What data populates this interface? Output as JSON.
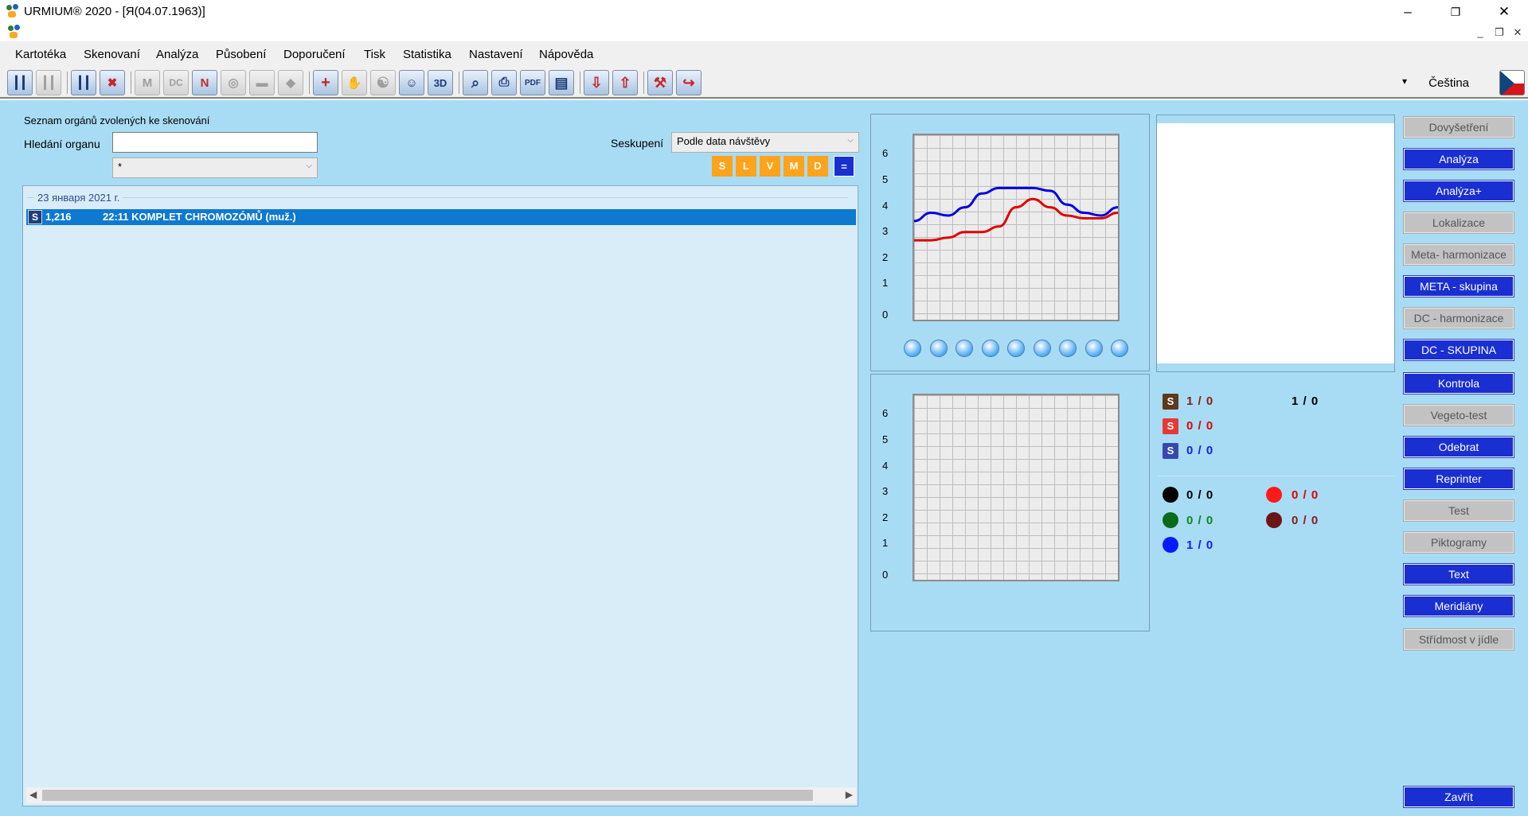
{
  "window": {
    "title": "URMIUM® 2020 - [Я(04.07.1963)]",
    "controls": {
      "minimize": "–",
      "maximize": "❐",
      "close": "✕"
    },
    "mdi_controls": {
      "minimize": "_",
      "restore": "❒",
      "close": "✕"
    }
  },
  "menu": [
    "Kartotéka",
    "Skenovaní",
    "Analýza",
    "Působení",
    "Doporučení",
    "Tisk",
    "Statistika",
    "Nastavení",
    "Nápověda"
  ],
  "toolbar": {
    "icons": [
      {
        "name": "scan-group-icon",
        "glyph": "┃┃"
      },
      {
        "name": "scan-compare-icon",
        "glyph": "┃┃"
      },
      {
        "name": "body-scan-icon",
        "glyph": "┃┃"
      },
      {
        "name": "organ-cancel-icon",
        "glyph": "✖"
      },
      {
        "name": "meta-icon",
        "glyph": "M"
      },
      {
        "name": "dc-icon",
        "glyph": "DC"
      },
      {
        "name": "neo-chart-icon",
        "glyph": "N"
      },
      {
        "name": "food-icon",
        "glyph": "◎"
      },
      {
        "name": "folder-icon",
        "glyph": "▬"
      },
      {
        "name": "drop-icon",
        "glyph": "◆"
      },
      {
        "name": "add-medical-icon",
        "glyph": "+"
      },
      {
        "name": "hand-icon",
        "glyph": "✋"
      },
      {
        "name": "yin-yang-icon",
        "glyph": "☯"
      },
      {
        "name": "body-view-icon",
        "glyph": "☺"
      },
      {
        "name": "3d-icon",
        "glyph": "3D"
      },
      {
        "name": "magnifier-icon",
        "glyph": "⌕"
      },
      {
        "name": "printer-icon",
        "glyph": "⎙"
      },
      {
        "name": "pdf-mail-icon",
        "glyph": "PDF"
      },
      {
        "name": "book-icon",
        "glyph": "▤"
      },
      {
        "name": "import-icon",
        "glyph": "⇩"
      },
      {
        "name": "export-icon",
        "glyph": "⇧"
      },
      {
        "name": "tools-icon",
        "glyph": "⚒"
      },
      {
        "name": "exit-icon",
        "glyph": "↪"
      }
    ],
    "language": "Čeština",
    "language_arrow": "▾"
  },
  "left": {
    "list_title": "Seznam orgánů zvolených ke skenování",
    "search_label": "Hledání organu",
    "search_value": "",
    "filter_value": "*",
    "group_label": "Seskupení",
    "group_value": "Podle data návštěvy",
    "filter_buttons": [
      "S",
      "L",
      "V",
      "M",
      "D",
      "="
    ],
    "group_header": "23 января 2021 г.",
    "rows": [
      {
        "icon": "S",
        "value": "1,216",
        "time_name": "22:11 KOMPLET CHROMOZÓMŮ (muž.)"
      }
    ]
  },
  "chart_data": [
    {
      "type": "line",
      "ylim": [
        0,
        7
      ],
      "yticks": [
        "0",
        "1",
        "2",
        "3",
        "4",
        "5",
        "6"
      ],
      "x": [
        0,
        1,
        2,
        3,
        4,
        5,
        6,
        7,
        8,
        9,
        10,
        11,
        12
      ],
      "series": [
        {
          "color": "#0000e0",
          "values": [
            3.3,
            3.6,
            3.5,
            3.8,
            4.3,
            4.5,
            4.5,
            4.5,
            4.4,
            3.9,
            3.6,
            3.5,
            3.8
          ]
        },
        {
          "color": "#e00000",
          "values": [
            2.6,
            2.6,
            2.7,
            2.9,
            2.9,
            3.1,
            3.8,
            4.1,
            3.8,
            3.5,
            3.4,
            3.4,
            3.6
          ]
        }
      ]
    },
    {
      "type": "line",
      "ylim": [
        0,
        7
      ],
      "yticks": [
        "0",
        "1",
        "2",
        "3",
        "4",
        "5",
        "6"
      ],
      "x": [],
      "series": []
    }
  ],
  "organ_icons": [
    "lung-icon",
    "nerve-icon",
    "sweat-icon",
    "joint-icon",
    "virus-icon",
    "stomach-icon",
    "bug-icon",
    "drop-icon",
    "brain-icon"
  ],
  "stats": {
    "s_black": {
      "value": "1 / 0",
      "extra": "1 / 0"
    },
    "s_red": {
      "value": "0 / 0"
    },
    "s_blue": {
      "value": "0 / 0"
    },
    "dots": [
      {
        "color": "#000000",
        "value": "0 / 0"
      },
      {
        "color": "#ff1a1a",
        "value": "0 / 0"
      },
      {
        "color": "#0a6b1a",
        "value": "0 / 0"
      },
      {
        "color": "#6b1515",
        "value": "0 / 0"
      },
      {
        "color": "#0a1aff",
        "value": "1 / 0"
      }
    ]
  },
  "side_buttons": [
    {
      "label": "Dovyšetření",
      "enabled": false
    },
    {
      "label": "Analýza",
      "enabled": true
    },
    {
      "label": "Analýza+",
      "enabled": true
    },
    {
      "label": "Lokalizace",
      "enabled": false
    },
    {
      "label": "Meta- harmonizace",
      "enabled": false
    },
    {
      "label": "META - skupina",
      "enabled": true
    },
    {
      "label": "DC - harmonizace",
      "enabled": false
    },
    {
      "label": "DC - SKUPINA",
      "enabled": true
    },
    {
      "label": "Kontrola",
      "enabled": true
    },
    {
      "label": "Vegeto-test",
      "enabled": false
    },
    {
      "label": "Odebrat",
      "enabled": true
    },
    {
      "label": "Reprinter",
      "enabled": true
    },
    {
      "label": "Test",
      "enabled": false
    },
    {
      "label": "Piktogramy",
      "enabled": false
    },
    {
      "label": "Text",
      "enabled": true
    },
    {
      "label": "Meridiány",
      "enabled": true
    },
    {
      "label": "Střídmost v jídle",
      "enabled": false
    }
  ],
  "close_button": "Zavřít"
}
